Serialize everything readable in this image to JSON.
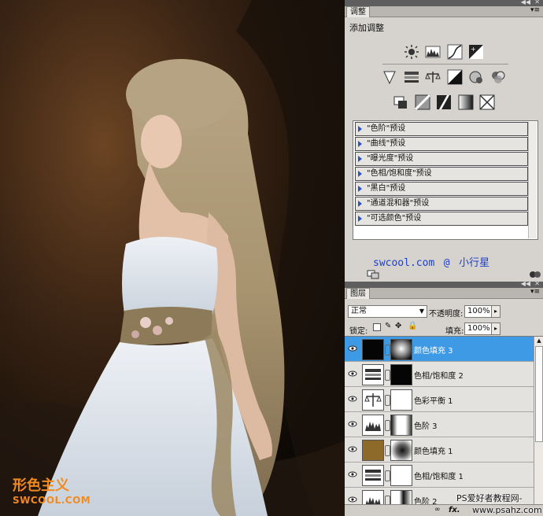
{
  "watermark_cn": "形色主义",
  "watermark_en": "SWCOOL.COM",
  "adjustments": {
    "tab": "调整",
    "title": "添加调整",
    "presets": [
      "\"色阶\"预设",
      "\"曲线\"预设",
      "\"曝光度\"预设",
      "\"色相/饱和度\"预设",
      "\"黑白\"预设",
      "\"通道混和器\"预设",
      "\"可选颜色\"预设"
    ],
    "signature_site": "swcool.com",
    "signature_at": "@",
    "signature_name": "小行星"
  },
  "layers": {
    "tab": "图层",
    "blend_mode": "正常",
    "opacity_label": "不透明度:",
    "opacity_value": "100%",
    "lock_label": "锁定:",
    "fill_label": "填充:",
    "fill_value": "100%",
    "items": [
      {
        "name": "颜色填充 3",
        "selected": true
      },
      {
        "name": "色相/饱和度 2",
        "selected": false
      },
      {
        "name": "色彩平衡 1",
        "selected": false
      },
      {
        "name": "色阶 3",
        "selected": false
      },
      {
        "name": "颜色填充 1",
        "selected": false
      },
      {
        "name": "色相/饱和度 1",
        "selected": false
      },
      {
        "name": "色阶 2",
        "selected": false
      }
    ],
    "bottom_fx": "fx."
  },
  "footer_watermark": "PS爱好者教程网-",
  "footer_url": "www.psahz.com",
  "colors": {
    "selected": "#3f9ae6",
    "accent_blue": "#1b3fd1",
    "watermark_orange": "#f28a1e"
  }
}
